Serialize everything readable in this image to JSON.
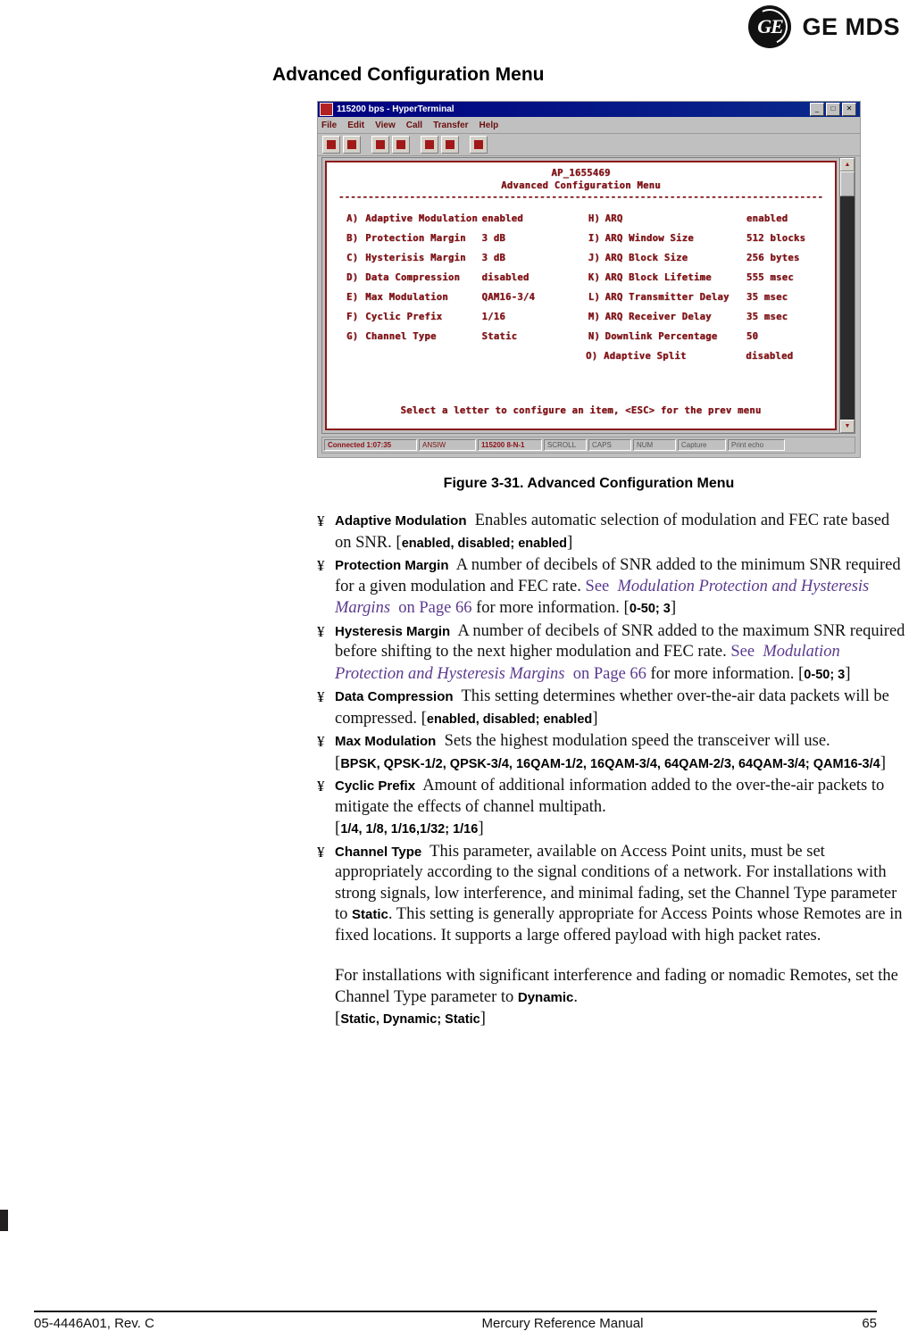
{
  "brand": {
    "logo_mark_text": "GE",
    "logo_word": "GE MDS"
  },
  "page_heading": "Advanced Configuration Menu",
  "terminal": {
    "title": "115200 bps - HyperTerminal",
    "window_buttons": [
      "_",
      "□",
      "✕"
    ],
    "menus": [
      "File",
      "Edit",
      "View",
      "Call",
      "Transfer",
      "Help"
    ],
    "screen": {
      "unit_id": "AP_1655469",
      "menu_title": "Advanced Configuration Menu",
      "rule": "----------------------------------------------------------------------------------",
      "left_items": [
        {
          "key": "A)",
          "label": "Adaptive Modulation",
          "value": "enabled"
        },
        {
          "key": "B)",
          "label": "Protection Margin",
          "value": "3 dB"
        },
        {
          "key": "C)",
          "label": "Hysterisis Margin",
          "value": "3 dB"
        },
        {
          "key": "D)",
          "label": "Data Compression",
          "value": "disabled"
        },
        {
          "key": "E)",
          "label": "Max Modulation",
          "value": "QAM16-3/4"
        },
        {
          "key": "F)",
          "label": "Cyclic Prefix",
          "value": "1/16"
        },
        {
          "key": "G)",
          "label": "Channel Type",
          "value": "Static"
        }
      ],
      "right_items": [
        {
          "key": "H)",
          "label": "ARQ",
          "value": "enabled"
        },
        {
          "key": "I)",
          "label": "ARQ Window Size",
          "value": "512 blocks"
        },
        {
          "key": "J)",
          "label": "ARQ Block Size",
          "value": "256 bytes"
        },
        {
          "key": "K)",
          "label": "ARQ Block Lifetime",
          "value": "555 msec"
        },
        {
          "key": "L)",
          "label": "ARQ Transmitter Delay",
          "value": "35 msec"
        },
        {
          "key": "M)",
          "label": "ARQ Receiver Delay",
          "value": "35 msec"
        },
        {
          "key": "N)",
          "label": "Downlink Percentage",
          "value": "50"
        },
        {
          "key": "O)",
          "label": "Adaptive Split",
          "value": "disabled"
        }
      ],
      "prompt": "Select a letter to configure an item, <ESC> for the prev menu"
    },
    "statusbar": {
      "connected": "Connected 1:07:35",
      "emulation": "ANSIW",
      "line_settings": "115200 8-N-1",
      "scroll": "SCROLL",
      "caps": "CAPS",
      "num": "NUM",
      "capture": "Capture",
      "print_echo": "Print echo"
    }
  },
  "figure_caption": "Figure 3-31. Advanced Configuration Menu",
  "bullets": [
    {
      "glyph": "¥",
      "term": "Adaptive Modulation",
      "text_1": "Enables automatic selection of modulation and FEC rate based on SNR. ",
      "options": "enabled, disabled; enabled"
    },
    {
      "glyph": "¥",
      "term": "Protection Margin",
      "text_1": "A number of decibels of SNR added to the minimum SNR required for a given modulation and FEC rate. ",
      "see": "See",
      "xref_title": "Modulation Protection and Hysteresis Margins",
      "xref_tail": " on Page 66",
      "text_2": " for more information. ",
      "options": "0-50; 3"
    },
    {
      "glyph": "¥",
      "term": "Hysteresis Margin",
      "text_1": "A number of decibels of SNR added to the maximum SNR required before shifting to the next higher modulation and FEC rate. ",
      "see": "See",
      "xref_title": "Modulation Protection and Hysteresis Margins",
      "xref_tail": " on Page 66",
      "text_2": " for more information. ",
      "options": "0-50; 3"
    },
    {
      "glyph": "¥",
      "term": "Data Compression",
      "text_1": "This setting determines whether over-the-air data packets will be compressed. ",
      "options": "enabled, disabled; enabled"
    },
    {
      "glyph": "¥",
      "term": "Max Modulation",
      "text_1": "Sets the highest modulation speed the transceiver will use.",
      "options": "BPSK, QPSK-1/2, QPSK-3/4, 16QAM-1/2, 16QAM-3/4, 64QAM-2/3, 64QAM-3/4; QAM16-3/4"
    },
    {
      "glyph": "¥",
      "term": "Cyclic Prefix",
      "text_1": "Amount of additional information added to the over-the-air packets to mitigate the effects of channel multipath.",
      "options": "1/4, 1/8, 1/16,1/32; 1/16"
    },
    {
      "glyph": "¥",
      "term": "Channel Type",
      "text_1": "This parameter, available on Access Point units, must be set appropriately according to the signal conditions of a network. For installations with strong signals, low interference, and minimal fading, set the Channel Type parameter to ",
      "inline_bold_1": "Static",
      "text_2": ". This setting is generally appropriate for Access Points whose Remotes are in fixed locations. It supports a large offered payload with high packet rates.",
      "paragraph_2a": "For installations with significant interference and fading or nomadic Remotes, set the Channel Type parameter to ",
      "inline_bold_2": "Dynamic",
      "paragraph_2b": ".",
      "options": "Static, Dynamic; Static"
    }
  ],
  "footer": {
    "left": "05-4446A01, Rev. C",
    "center": "Mercury Reference Manual",
    "right": "65"
  }
}
